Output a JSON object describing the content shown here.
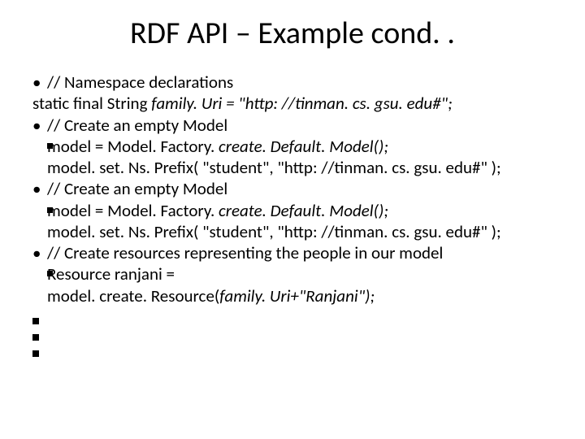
{
  "title": "RDF API – Example cond. .",
  "b1_comment": "// Namespace declarations",
  "b1_line": "static final String family. Uri = \"http: //tinman. cs. gsu. edu#\";",
  "b2_comment": "// Create an empty Model",
  "b2_l1": "model = Model. Factory. create. Default. Model();",
  "b2_l2": "model. set. Ns. Prefix( \"student\", \"http: //tinman. cs. gsu. edu#\" );",
  "b3_comment": "// Create an empty Model",
  "b3_l1": "model = Model. Factory. create. Default. Model();",
  "b3_l2": "model. set. Ns. Prefix( \"student\", \"http: //tinman. cs. gsu. edu#\" );",
  "b4_comment": "// Create resources representing the people in our model",
  "b4_l1": "Resource ranjani =",
  "b4_l2": "model. create. Resource(family. Uri+\"Ranjani\");"
}
